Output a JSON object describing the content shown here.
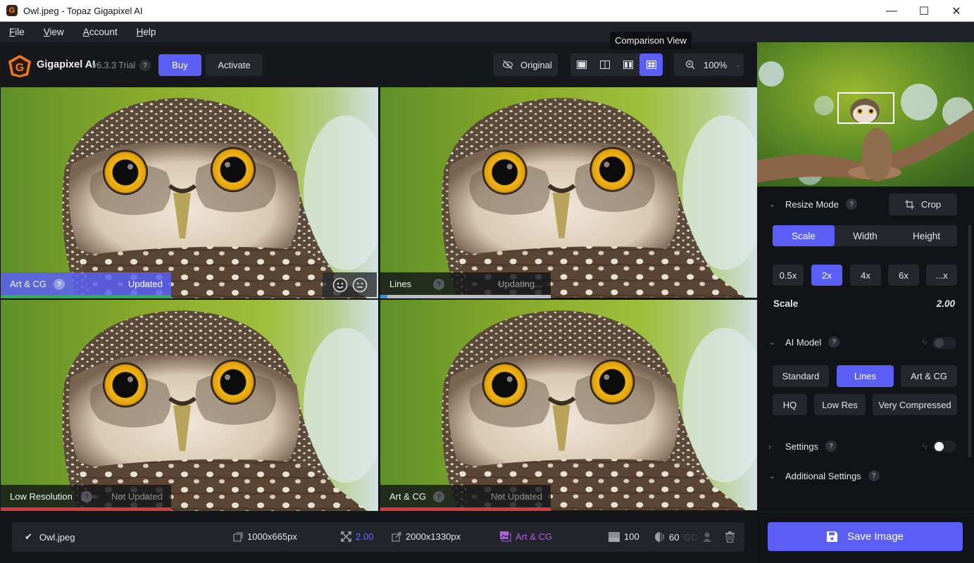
{
  "window": {
    "title": "Owl.jpeg - Topaz Gigapixel AI",
    "app_icon": "G",
    "controls": {
      "minimize": "—",
      "maximize": "☐",
      "close": "✕"
    }
  },
  "menu": {
    "items": [
      {
        "label_hot": "F",
        "label_rest": "ile"
      },
      {
        "label_hot": "V",
        "label_rest": "iew"
      },
      {
        "label_hot": "A",
        "label_rest": "ccount"
      },
      {
        "label_hot": "H",
        "label_rest": "elp"
      }
    ]
  },
  "toolbar": {
    "brand": "Gigapixel AI",
    "version": "v6.3.3 Trial",
    "help": "?",
    "buy_label": "Buy",
    "activate_label": "Activate",
    "original_label": "Original",
    "tooltip": "Comparison View",
    "zoom_value": "100%",
    "view_modes": [
      "single-view",
      "split-view",
      "side-by-side-view",
      "comparison-view"
    ],
    "active_view": "comparison-view"
  },
  "panes": [
    {
      "model": "Art & CG",
      "status": "Updated",
      "state": "updated",
      "progress": 1.0,
      "status_color": "#ffffff",
      "label_bg": "rgba(91,95,245,0.85)",
      "bar_color": "#2fae5b",
      "show_rating": true
    },
    {
      "model": "Lines",
      "status": "Updating...",
      "state": "updating",
      "progress": 0.04,
      "status_color": "#9a9ca3",
      "label_bg": "rgba(20,22,26,0.82)",
      "bar_color": "#3a8ff5",
      "show_rating": false
    },
    {
      "model": "Low Resolution",
      "status": "Not Updated",
      "state": "not-updated",
      "progress": 1.0,
      "status_color": "#8a8d94",
      "label_bg": "rgba(20,22,26,0.82)",
      "bar_color": "#d9383f",
      "show_rating": false
    },
    {
      "model": "Art & CG",
      "status": "Not Updated",
      "state": "not-updated",
      "progress": 1.0,
      "status_color": "#8a8d94",
      "label_bg": "rgba(20,22,26,0.82)",
      "bar_color": "#d9383f",
      "show_rating": false
    }
  ],
  "sidebar": {
    "resize_mode": {
      "title": "Resize Mode",
      "help": "?",
      "crop_label": "Crop",
      "tabs": [
        "Scale",
        "Width",
        "Height"
      ],
      "active_tab": "Scale",
      "scales": [
        "0.5x",
        "2x",
        "4x",
        "6x",
        "...x"
      ],
      "active_scale": "2x",
      "scale_label": "Scale",
      "scale_value": "2.00"
    },
    "ai_model": {
      "title": "AI Model",
      "help": "?",
      "auto_toggle_on": false,
      "row1": [
        "Standard",
        "Lines",
        "Art & CG"
      ],
      "row2": [
        "HQ",
        "Low Res",
        "Very Compressed"
      ],
      "active": "Lines"
    },
    "settings": {
      "title": "Settings",
      "help": "?",
      "toggle_on": true
    },
    "additional_settings": {
      "title": "Additional Settings",
      "help": "?"
    },
    "save_label": "Save Image"
  },
  "infobar": {
    "filename": "Owl.jpeg",
    "input_size": "1000x665px",
    "scale": "2.00",
    "output_size": "2000x1330px",
    "model": "Art & CG",
    "noise": "100",
    "blur": "60",
    "gc": "GC"
  },
  "colors": {
    "accent": "#5b5ff5",
    "model_purple": "#b061d6",
    "updated_green": "#2fae5b",
    "not_updated_red": "#d9383f"
  }
}
